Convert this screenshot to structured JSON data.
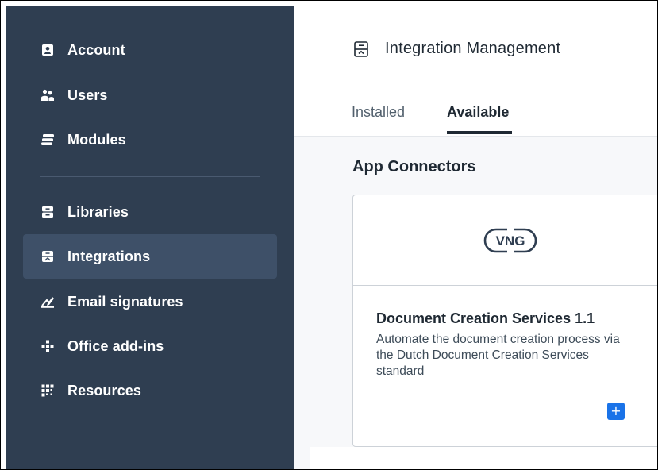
{
  "sidebar": {
    "items": [
      {
        "label": "Account",
        "icon": "account-icon"
      },
      {
        "label": "Users",
        "icon": "users-icon"
      },
      {
        "label": "Modules",
        "icon": "modules-icon"
      },
      {
        "label": "Libraries",
        "icon": "libraries-icon"
      },
      {
        "label": "Integrations",
        "icon": "integrations-icon",
        "active": true
      },
      {
        "label": "Email signatures",
        "icon": "email-signature-icon"
      },
      {
        "label": "Office add-ins",
        "icon": "office-addins-icon"
      },
      {
        "label": "Resources",
        "icon": "resources-icon"
      }
    ]
  },
  "header": {
    "title": "Integration Management",
    "icon": "integration-management-icon",
    "tabs": [
      {
        "label": "Installed",
        "active": false
      },
      {
        "label": "Available",
        "active": true
      }
    ]
  },
  "main": {
    "section_title": "App Connectors",
    "card": {
      "logo": "VNG",
      "title": "Document Creation Services 1.1",
      "description": "Automate the document creation process via the Dutch Document Creation Services standard",
      "add_label": "+"
    }
  },
  "colors": {
    "sidebar_bg": "#2f3e51",
    "sidebar_active": "#3e5068",
    "accent": "#1a73e8"
  }
}
